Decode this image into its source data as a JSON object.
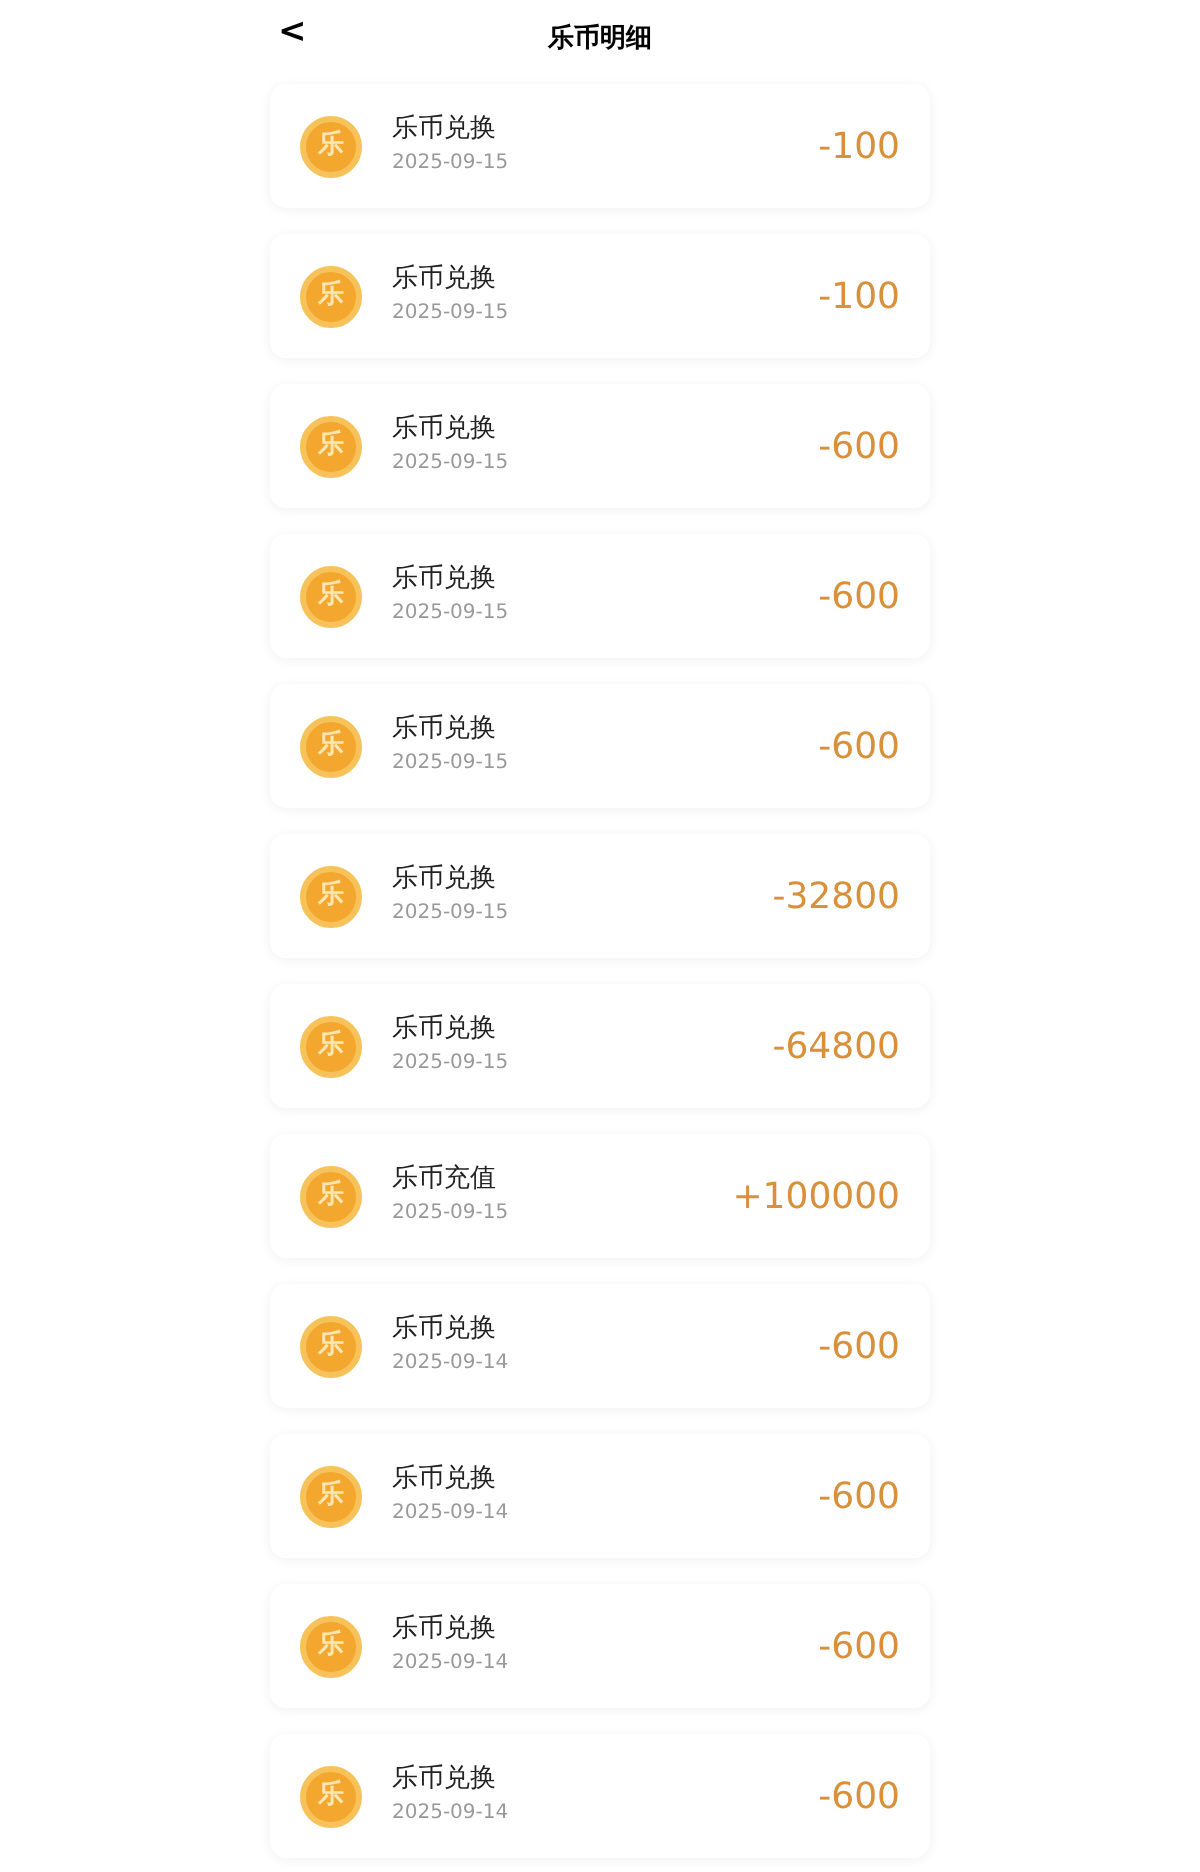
{
  "header": {
    "back": "<",
    "title": "乐币明细"
  },
  "records": [
    {
      "coin": "乐",
      "title": "乐币兑换",
      "date": "2025-09-15",
      "amount": "-100"
    },
    {
      "coin": "乐",
      "title": "乐币兑换",
      "date": "2025-09-15",
      "amount": "-100"
    },
    {
      "coin": "乐",
      "title": "乐币兑换",
      "date": "2025-09-15",
      "amount": "-600"
    },
    {
      "coin": "乐",
      "title": "乐币兑换",
      "date": "2025-09-15",
      "amount": "-600"
    },
    {
      "coin": "乐",
      "title": "乐币兑换",
      "date": "2025-09-15",
      "amount": "-600"
    },
    {
      "coin": "乐",
      "title": "乐币兑换",
      "date": "2025-09-15",
      "amount": "-32800"
    },
    {
      "coin": "乐",
      "title": "乐币兑换",
      "date": "2025-09-15",
      "amount": "-64800"
    },
    {
      "coin": "乐",
      "title": "乐币充值",
      "date": "2025-09-15",
      "amount": "+100000"
    },
    {
      "coin": "乐",
      "title": "乐币兑换",
      "date": "2025-09-14",
      "amount": "-600"
    },
    {
      "coin": "乐",
      "title": "乐币兑换",
      "date": "2025-09-14",
      "amount": "-600"
    },
    {
      "coin": "乐",
      "title": "乐币兑换",
      "date": "2025-09-14",
      "amount": "-600"
    },
    {
      "coin": "乐",
      "title": "乐币兑换",
      "date": "2025-09-14",
      "amount": "-600"
    }
  ]
}
